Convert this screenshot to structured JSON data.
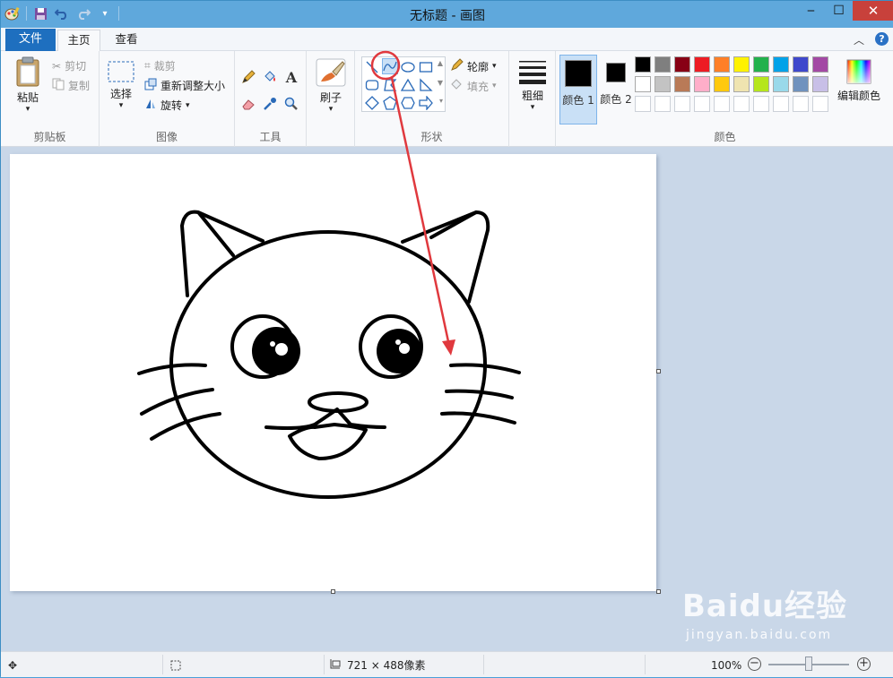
{
  "titlebar": {
    "title": "无标题 - 画图"
  },
  "tabs": {
    "file": "文件",
    "home": "主页",
    "view": "查看"
  },
  "clipboard": {
    "paste": "粘贴",
    "cut": "剪切",
    "copy": "复制",
    "label": "剪贴板"
  },
  "image": {
    "select": "选择",
    "crop": "裁剪",
    "resize": "重新调整大小",
    "rotate": "旋转",
    "label": "图像"
  },
  "tools": {
    "label": "工具"
  },
  "brushes": {
    "label": "刷子"
  },
  "shapes": {
    "outline": "轮廓",
    "fill": "填充",
    "label": "形状"
  },
  "size": {
    "label": "粗细"
  },
  "colors": {
    "color1": "颜色 1",
    "color2": "颜色 2",
    "edit": "编辑颜色",
    "label": "颜色",
    "color1_value": "#000000",
    "color2_value": "#000000",
    "palette_row1": [
      "#000000",
      "#7f7f7f",
      "#880015",
      "#ed1c24",
      "#ff7f27",
      "#fff200",
      "#22b14c",
      "#00a2e8",
      "#3f48cc",
      "#a349a4"
    ],
    "palette_row2": [
      "#ffffff",
      "#c3c3c3",
      "#b97a57",
      "#ffaec9",
      "#ffc90e",
      "#efe4b0",
      "#b5e61d",
      "#99d9ea",
      "#7092be",
      "#c8bfe7"
    ]
  },
  "status": {
    "dimensions": "721 × 488像素",
    "zoom": "100%",
    "zoom_level": 1.0
  },
  "watermark": {
    "brand": "Baidu经验",
    "url": "jingyan.baidu.com"
  },
  "accent": {
    "file_tab": "#1e6fbf",
    "titlebar": "#5fa8dc",
    "annotation": "#e0393e"
  }
}
